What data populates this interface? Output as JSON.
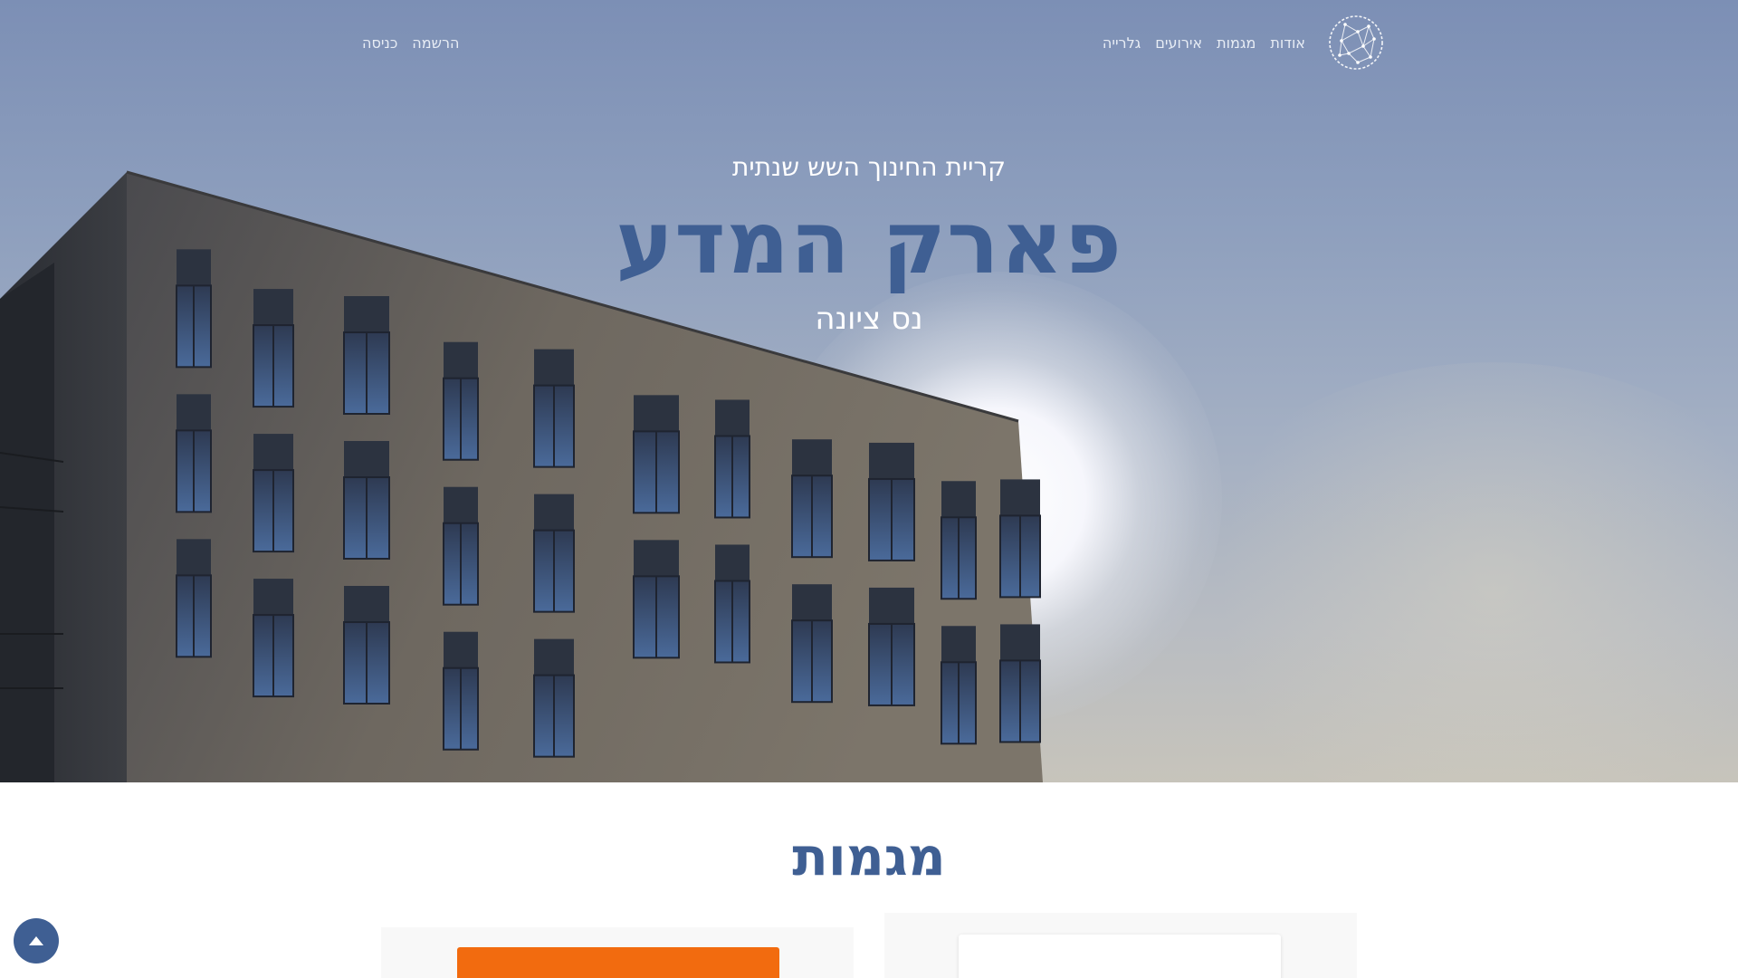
{
  "nav": {
    "logo_icon": "globe-network-logo",
    "links": [
      {
        "label": "אודות"
      },
      {
        "label": "מגמות"
      },
      {
        "label": "אירועים"
      },
      {
        "label": "גלרייה"
      }
    ],
    "auth": {
      "register": "הרשמה",
      "login": "כניסה"
    }
  },
  "hero": {
    "subtitle": "קריית החינוך השש שנתית",
    "title": "פארק המדע",
    "city": "נס ציונה"
  },
  "section": {
    "title": "מגמות"
  },
  "colors": {
    "brand_blue": "#3f5f93",
    "accent_orange": "#f26b0f"
  },
  "back_to_top": {
    "icon": "arrow-up-icon"
  }
}
